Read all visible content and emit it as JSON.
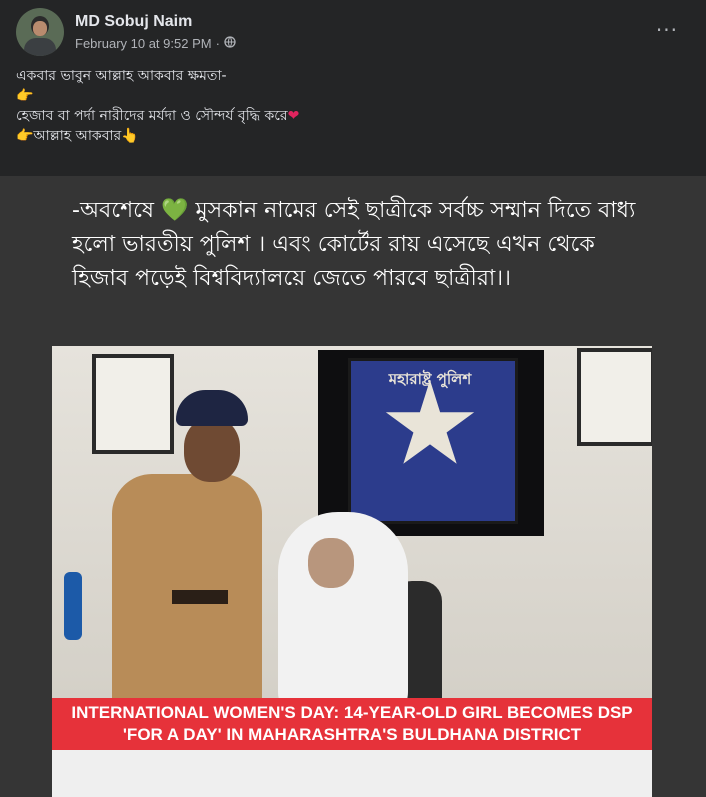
{
  "post": {
    "author_name": "MD Sobuj Naim",
    "timestamp": "February 10 at 9:52 PM",
    "separator": "·",
    "audience_icon": "globe-icon",
    "more_label": "···",
    "caption_lines": [
      "একবার ভাবুন আল্লাহ আকবার ক্ষমতা-",
      "👉",
      "হেজাব বা পর্দা নারীদের মর্যদা ও সৌন্দর্য বৃদ্ধি করে",
      "👉আল্লাহ আকবার👆"
    ],
    "heart_emoji": "❤"
  },
  "media": {
    "overlay_prefix": "-অবশেষে ",
    "green_heart_emoji": "💚",
    "overlay_text": " মুসকান নামের সেই ছাত্রীকে সর্বচ্চ সম্মান দিতে বাধ্য হলো ভারতীয় পুলিশ । এবং কোর্টের রায় এসেছে এখন থেকে হিজাব পড়েই বিশ্ববিদ্যালয়ে জেতে পারবে ছাত্রীরা।।",
    "emblem_text": "মহারাষ্ট্র পুলিশ",
    "banner_line1": "INTERNATIONAL WOMEN'S DAY: 14-YEAR-OLD GIRL BECOMES DSP",
    "banner_line2": "'FOR A DAY' IN MAHARASHTRA'S BULDHANA DISTRICT"
  },
  "colors": {
    "background": "#242526",
    "text": "#e4e6eb",
    "secondary_text": "#b0b3b8",
    "banner": "#e6323a"
  }
}
